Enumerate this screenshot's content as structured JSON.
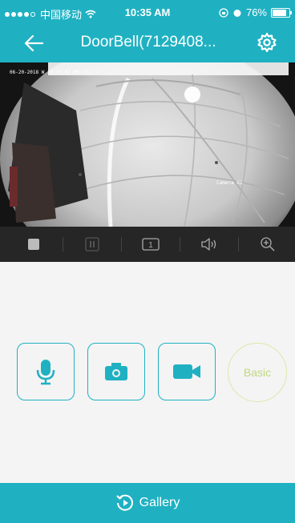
{
  "status_bar": {
    "carrier": "中国移动",
    "time": "10:35 AM",
    "battery": "76%"
  },
  "header": {
    "title": "DoorBell(7129408..."
  },
  "video": {
    "osd_timestamp": "06-20-2018 W 10:35:07 PM (3)",
    "camera_label": "Camera 01"
  },
  "controls": {
    "view_label": "1"
  },
  "actions": {
    "basic_label": "Basic"
  },
  "footer": {
    "gallery_label": "Gallery"
  },
  "colors": {
    "accent": "#1fb1c2",
    "basic_circle": "#d9e9a8"
  }
}
